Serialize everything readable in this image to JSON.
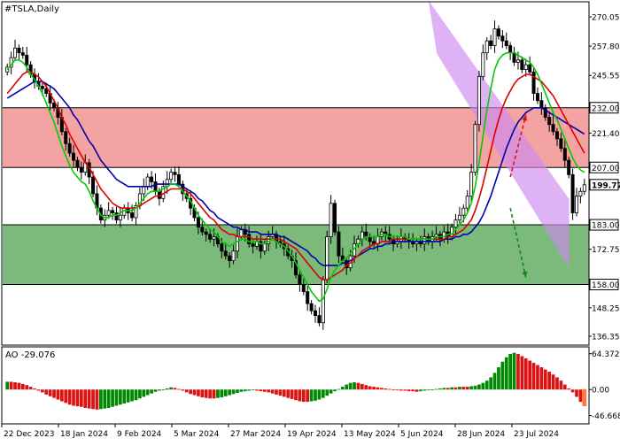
{
  "header": {
    "symbol_label": "#TSLA,Daily"
  },
  "indicator": {
    "label": "AO -29.076"
  },
  "colors": {
    "resistance_zone": "#f08080",
    "support_zone": "#3c9a3c",
    "channel": "#cc88ee",
    "ma_fast": "#00cc00",
    "ma_mid": "#dd0000",
    "ma_slow": "#0000aa",
    "ao_up": "#008800",
    "ao_down": "#dd1111",
    "arrow_up": "#dd1111",
    "arrow_down": "#118811"
  },
  "chart_data": [
    {
      "type": "line",
      "title": "#TSLA,Daily",
      "description_series": [
        "price candles",
        "fast MA (green)",
        "mid MA (red)",
        "slow MA (blue)"
      ],
      "x_tick_labels": [
        "22 Dec 2023",
        "18 Jan 2024",
        "9 Feb 2024",
        "5 Mar 2024",
        "27 Mar 2024",
        "19 Apr 2024",
        "13 May 2024",
        "5 Jun 2024",
        "28 Jun 2024",
        "23 Jul 2024"
      ],
      "y_tick_labels": [
        "270.05",
        "257.80",
        "245.55",
        "232.00",
        "221.40",
        "207.00",
        "199.77",
        "183.00",
        "172.75",
        "158.00",
        "148.25",
        "136.35"
      ],
      "ylim": [
        133,
        276
      ],
      "price_levels": [
        {
          "label": "232.00",
          "value": 232.0,
          "style": "boxed"
        },
        {
          "label": "207.00",
          "value": 207.0,
          "style": "boxed"
        },
        {
          "label": "199.77",
          "value": 199.77,
          "style": "current"
        },
        {
          "label": "183.00",
          "value": 183.0,
          "style": "boxed"
        },
        {
          "label": "158.00",
          "value": 158.0,
          "style": "boxed"
        }
      ],
      "zones": [
        {
          "from": 207.0,
          "to": 232.0,
          "color": "#f08080"
        },
        {
          "from": 158.0,
          "to": 183.0,
          "color": "#3c9a3c"
        }
      ],
      "channel": {
        "upper_start": [
          108,
          277
        ],
        "upper_end": [
          135,
          193
        ],
        "lower_start": [
          117,
          259
        ],
        "lower_end": [
          135,
          165
        ]
      },
      "arrows": [
        {
          "from": [
            129,
            203
          ],
          "to": [
            133,
            229
          ],
          "color": "#dd1111"
        },
        {
          "from": [
            129,
            190
          ],
          "to": [
            133,
            161
          ],
          "color": "#118811"
        }
      ],
      "closes": [
        249,
        253,
        257,
        255,
        254,
        250,
        246,
        243,
        241,
        240,
        238,
        234,
        232,
        228,
        222,
        217,
        213,
        210,
        207,
        205,
        209,
        203,
        196,
        190,
        185,
        187,
        189,
        188,
        185,
        187,
        190,
        188,
        186,
        191,
        196,
        199,
        203,
        201,
        197,
        194,
        199,
        202,
        205,
        204,
        200,
        196,
        194,
        190,
        186,
        182,
        180,
        179,
        177,
        178,
        175,
        172,
        170,
        168,
        172,
        178,
        181,
        179,
        175,
        174,
        176,
        172,
        175,
        178,
        179,
        176,
        175,
        173,
        170,
        168,
        162,
        158,
        155,
        150,
        147,
        145,
        142,
        160,
        178,
        192,
        180,
        170,
        168,
        165,
        170,
        175,
        177,
        180,
        178,
        176,
        175,
        178,
        180,
        179,
        177,
        175,
        176,
        178,
        177,
        176,
        175,
        176,
        175,
        178,
        176,
        178,
        179,
        177,
        180,
        178,
        182,
        185,
        187,
        190,
        195,
        205,
        225,
        245,
        255,
        260,
        258,
        265,
        262,
        260,
        258,
        255,
        251,
        252,
        248,
        250,
        247,
        238,
        235,
        232,
        228,
        225,
        222,
        219,
        215,
        210,
        204,
        188,
        195,
        197,
        199.77
      ],
      "ma_fast": [
        248,
        250,
        252,
        252,
        251,
        249,
        246,
        244,
        241,
        238,
        234,
        230,
        226,
        221,
        216,
        212,
        208,
        205,
        203,
        201,
        200,
        197,
        193,
        190,
        187,
        186,
        186,
        187,
        187,
        188,
        189,
        189,
        189,
        190,
        192,
        194,
        196,
        197,
        197,
        197,
        198,
        199,
        200,
        200,
        199,
        197,
        195,
        193,
        190,
        187,
        185,
        183,
        181,
        180,
        178,
        176,
        175,
        174,
        175,
        176,
        177,
        177,
        176,
        176,
        176,
        175,
        175,
        176,
        177,
        176,
        175,
        174,
        172,
        170,
        167,
        164,
        161,
        158,
        155,
        153,
        151,
        152,
        156,
        161,
        164,
        166,
        168,
        169,
        171,
        173,
        175,
        177,
        178,
        178,
        178,
        178,
        179,
        179,
        178,
        178,
        178,
        178,
        178,
        177,
        177,
        177,
        177,
        177,
        177,
        177,
        178,
        178,
        178,
        179,
        179,
        181,
        183,
        185,
        188,
        192,
        199,
        209,
        220,
        231,
        240,
        248,
        252,
        254,
        255,
        255,
        255,
        254,
        253,
        252,
        251,
        249,
        246,
        242,
        238,
        234,
        230,
        227,
        223,
        219,
        215,
        211,
        208,
        206,
        205
      ],
      "ma_mid": [
        238,
        240,
        242,
        244,
        246,
        247,
        247,
        246,
        245,
        243,
        241,
        238,
        235,
        232,
        228,
        225,
        221,
        218,
        215,
        212,
        209,
        207,
        204,
        201,
        198,
        196,
        194,
        192,
        191,
        190,
        190,
        190,
        190,
        190,
        191,
        192,
        193,
        194,
        195,
        195,
        196,
        197,
        198,
        198,
        198,
        198,
        197,
        196,
        194,
        192,
        190,
        188,
        186,
        185,
        183,
        181,
        180,
        179,
        179,
        178,
        178,
        178,
        178,
        177,
        177,
        177,
        177,
        177,
        177,
        177,
        177,
        176,
        175,
        174,
        173,
        171,
        169,
        167,
        165,
        163,
        161,
        160,
        160,
        161,
        162,
        163,
        164,
        166,
        167,
        169,
        170,
        172,
        173,
        174,
        175,
        175,
        176,
        176,
        176,
        177,
        177,
        177,
        177,
        177,
        177,
        177,
        177,
        177,
        177,
        177,
        177,
        177,
        177,
        178,
        178,
        179,
        180,
        181,
        183,
        185,
        189,
        194,
        200,
        207,
        214,
        221,
        227,
        232,
        236,
        239,
        242,
        244,
        245,
        246,
        246,
        245,
        244,
        243,
        241,
        239,
        237,
        234,
        231,
        228,
        225,
        222,
        219,
        216,
        213
      ],
      "ma_slow": [
        236,
        237,
        238,
        239,
        240,
        241,
        242,
        243,
        243,
        243,
        242,
        241,
        240,
        238,
        236,
        234,
        232,
        229,
        227,
        224,
        221,
        218,
        216,
        213,
        210,
        208,
        206,
        204,
        202,
        201,
        200,
        199,
        199,
        199,
        199,
        199,
        199,
        199,
        200,
        200,
        200,
        200,
        200,
        200,
        200,
        199,
        198,
        197,
        196,
        194,
        193,
        191,
        189,
        188,
        186,
        185,
        184,
        183,
        182,
        182,
        181,
        181,
        180,
        180,
        180,
        179,
        179,
        179,
        179,
        179,
        178,
        178,
        177,
        176,
        175,
        174,
        173,
        172,
        170,
        169,
        167,
        166,
        166,
        166,
        166,
        166,
        167,
        167,
        168,
        169,
        170,
        171,
        172,
        173,
        173,
        174,
        174,
        175,
        175,
        176,
        176,
        176,
        176,
        176,
        176,
        176,
        176,
        176,
        176,
        176,
        176,
        176,
        177,
        177,
        177,
        178,
        178,
        179,
        179,
        180,
        182,
        184,
        187,
        191,
        195,
        200,
        205,
        210,
        215,
        219,
        223,
        226,
        228,
        230,
        231,
        232,
        232,
        232,
        231,
        230,
        229,
        228,
        227,
        226,
        225,
        224,
        223,
        222,
        221
      ]
    },
    {
      "type": "bar",
      "title": "AO -29.076",
      "y_tick_labels": [
        "64.372",
        "0.00",
        "-46.668"
      ],
      "ylim": [
        -60,
        75
      ],
      "values": [
        14,
        14,
        13,
        12,
        10,
        8,
        5,
        2,
        -2,
        -5,
        -9,
        -12,
        -15,
        -18,
        -21,
        -24,
        -27,
        -29,
        -30,
        -31,
        -33,
        -34,
        -35,
        -36,
        -35,
        -34,
        -33,
        -31,
        -29,
        -27,
        -25,
        -23,
        -21,
        -19,
        -16,
        -13,
        -10,
        -7,
        -4,
        -2,
        0,
        2,
        4,
        3,
        1,
        -2,
        -5,
        -8,
        -10,
        -12,
        -14,
        -15,
        -16,
        -16,
        -15,
        -14,
        -12,
        -10,
        -8,
        -6,
        -4,
        -3,
        -2,
        -1,
        -2,
        -3,
        -4,
        -5,
        -7,
        -9,
        -11,
        -13,
        -15,
        -17,
        -19,
        -21,
        -22,
        -22,
        -21,
        -20,
        -18,
        -15,
        -11,
        -7,
        -3,
        1,
        5,
        9,
        12,
        13,
        12,
        10,
        8,
        6,
        5,
        4,
        3,
        2,
        1,
        0,
        -1,
        -2,
        -2,
        -3,
        -3,
        -4,
        -3,
        -2,
        -1,
        0,
        1,
        2,
        3,
        3,
        4,
        4,
        5,
        5,
        5,
        6,
        7,
        9,
        12,
        16,
        22,
        30,
        40,
        50,
        58,
        64,
        66,
        64,
        60,
        56,
        52,
        48,
        44,
        40,
        36,
        32,
        27,
        22,
        16,
        9,
        2,
        -5,
        -13,
        -22,
        -29
      ]
    }
  ]
}
